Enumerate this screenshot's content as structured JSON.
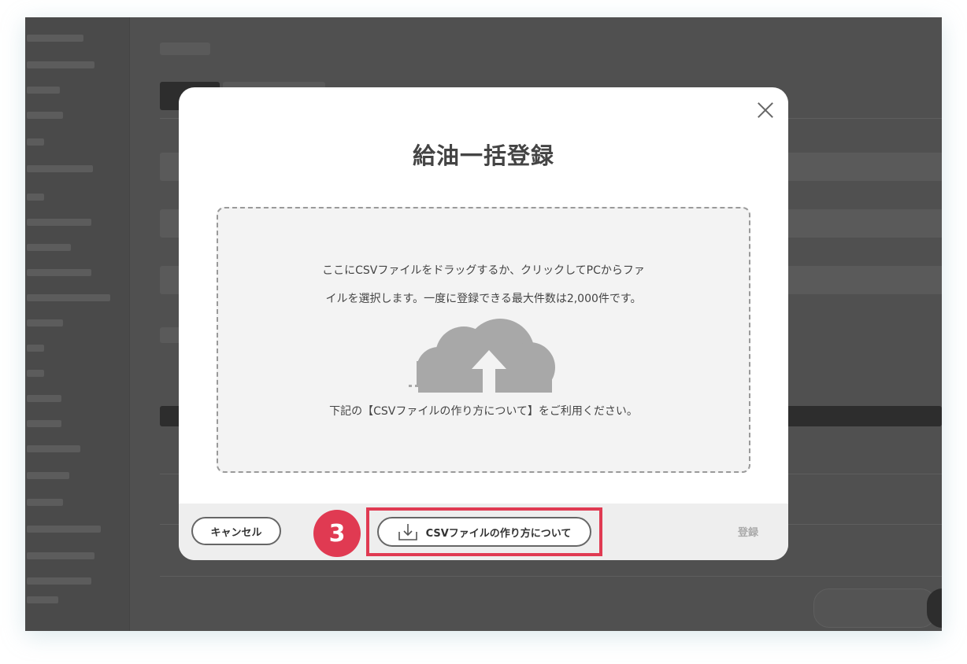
{
  "modal": {
    "title": "給油一括登録",
    "dropzone": {
      "line1": "ここにCSVファイルをドラッグするか、クリックしてPCからファ",
      "line2": "イルを選択します。一度に登録できる最大件数は2,000件です。",
      "line3": "下記の【CSVファイルの作り方について】をご利用ください。",
      "icon": "cloud-upload-icon"
    },
    "footer": {
      "cancel_label": "キャンセル",
      "step_number": "3",
      "howto_label": "CSVファイルの作り方について",
      "howto_icon": "download-icon",
      "register_label": "登録"
    }
  },
  "colors": {
    "overlay": "#4e4e4e",
    "accent_red": "#e03a52",
    "dropzone_bg": "#f3f3f3",
    "icon_gray": "#a8a8a8"
  }
}
